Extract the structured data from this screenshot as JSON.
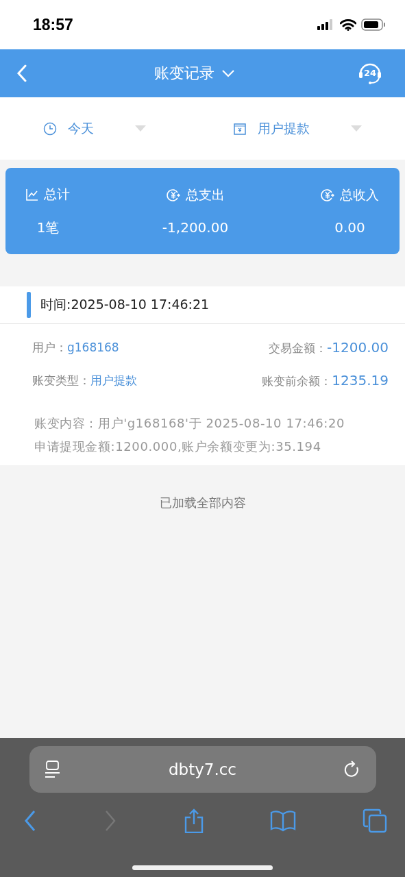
{
  "status_bar": {
    "time": "18:57"
  },
  "header": {
    "title": "账变记录",
    "support_badge": "24"
  },
  "filters": [
    {
      "kind": "date",
      "label": "今天"
    },
    {
      "kind": "type",
      "label": "用户提款"
    }
  ],
  "summary": [
    {
      "kind": "count",
      "label": "总计",
      "value": "1笔"
    },
    {
      "kind": "money",
      "label": "总支出",
      "value": "-1,200.00"
    },
    {
      "kind": "money",
      "label": "总收入",
      "value": "0.00"
    }
  ],
  "records": [
    {
      "time": "时间:2025-08-10 17:46:21",
      "user_label": "用户：",
      "user": "g168168",
      "amount_label": "交易金额：",
      "amount": "-1200.00",
      "type_label": "账变类型：",
      "type": "用户提款",
      "balance_label": "账变前余额：",
      "balance": "1235.19",
      "content": "账变内容：用户'g168168'于 2025-08-10 17:46:20 申请提现金额:1200.000,账户余额变更为:35.194"
    }
  ],
  "list_end": "已加载全部内容",
  "browser": {
    "url": "dbty7.cc",
    "toolbar": [
      {
        "kind": "back",
        "disabled": false
      },
      {
        "kind": "forward",
        "disabled": true
      },
      {
        "kind": "share",
        "disabled": false
      },
      {
        "kind": "bookmarks",
        "disabled": false
      },
      {
        "kind": "tabs",
        "disabled": false
      }
    ]
  }
}
